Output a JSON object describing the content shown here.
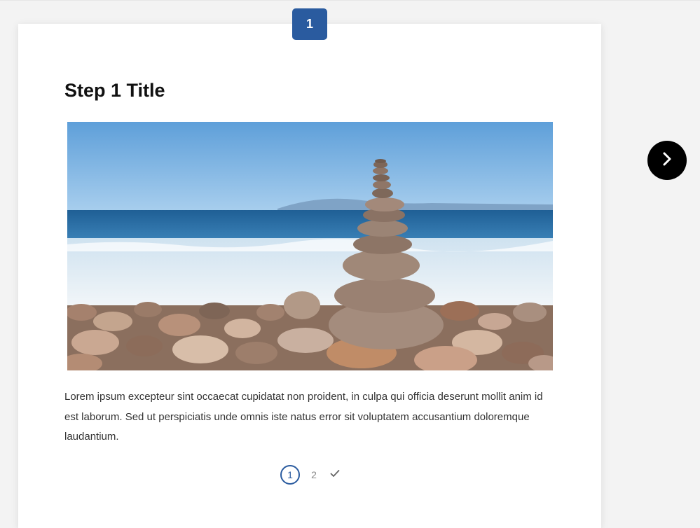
{
  "step_badge": "1",
  "step": {
    "title": "Step 1 Title",
    "body": "Lorem ipsum excepteur sint occaecat cupidatat non proident, in culpa qui officia deserunt mollit anim id est laborum. Sed ut perspiciatis unde omnis iste natus error sit voluptatem accusantium doloremque laudantium."
  },
  "pager": {
    "items": [
      "1",
      "2"
    ],
    "complete_icon": "checkmark-icon"
  },
  "navigation": {
    "next_icon": "chevron-right-icon"
  },
  "colors": {
    "accent": "#2a5b9f",
    "background": "#f3f3f3",
    "card": "#ffffff",
    "next_button": "#000000"
  }
}
